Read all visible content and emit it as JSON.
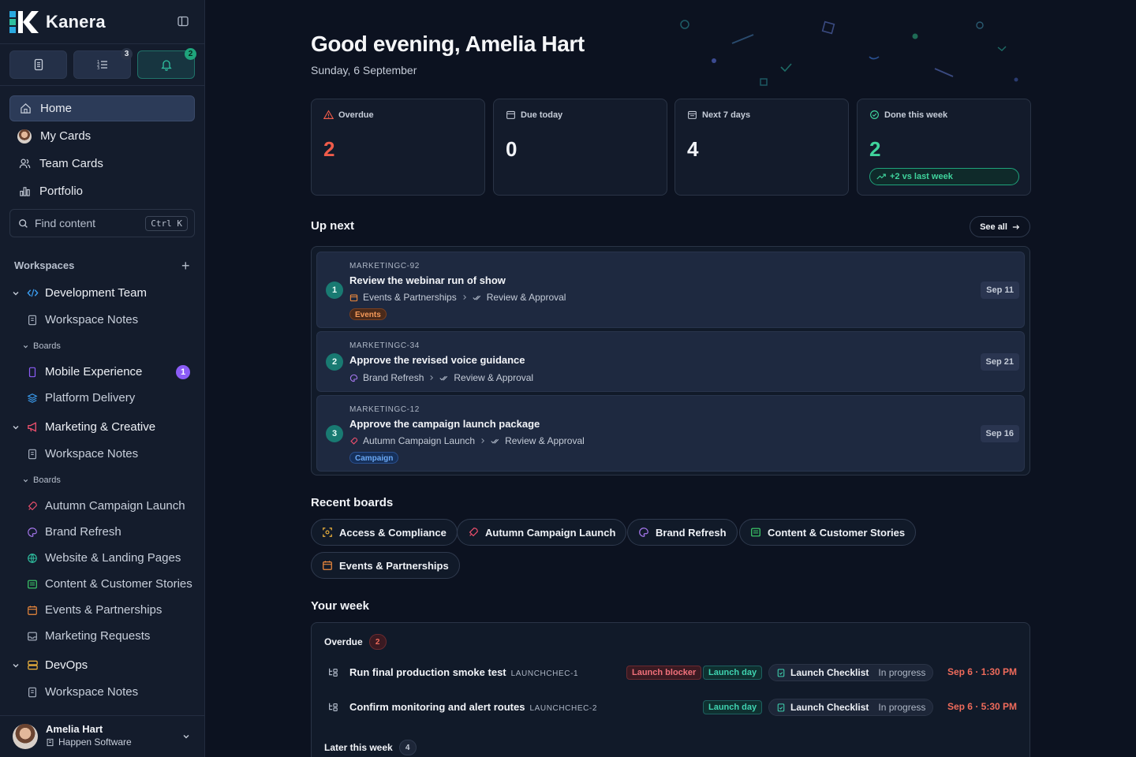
{
  "brand": {
    "name": "Kanera"
  },
  "quick_actions": [
    {
      "icon": "document-icon"
    },
    {
      "icon": "list-icon",
      "badge": "3"
    },
    {
      "icon": "bell-icon",
      "badge": "2"
    }
  ],
  "nav": [
    {
      "label": "Home",
      "icon": "home-icon"
    },
    {
      "label": "My Cards",
      "icon": "avatar"
    },
    {
      "label": "Team Cards",
      "icon": "users-icon"
    },
    {
      "label": "Portfolio",
      "icon": "chart-icon"
    }
  ],
  "search": {
    "placeholder": "Find content",
    "shortcut": "Ctrl K"
  },
  "workspaces": {
    "heading": "Workspaces",
    "items": [
      {
        "name": "Development Team",
        "notes": "Workspace Notes",
        "boards_label": "Boards",
        "boards": [
          {
            "name": "Mobile Experience",
            "badge": "1"
          },
          {
            "name": "Platform Delivery"
          }
        ]
      },
      {
        "name": "Marketing & Creative",
        "notes": "Workspace Notes",
        "boards_label": "Boards",
        "boards": [
          {
            "name": "Autumn Campaign Launch"
          },
          {
            "name": "Brand Refresh"
          },
          {
            "name": "Website & Landing Pages"
          },
          {
            "name": "Content & Customer Stories"
          },
          {
            "name": "Events & Partnerships"
          },
          {
            "name": "Marketing Requests"
          }
        ]
      },
      {
        "name": "DevOps",
        "notes": "Workspace Notes"
      }
    ]
  },
  "user": {
    "name": "Amelia Hart",
    "org": "Happen Software"
  },
  "greeting": "Good evening, Amelia Hart",
  "date": "Sunday, 6 September",
  "stats": [
    {
      "label": "Overdue",
      "value": "2",
      "color": "#ef5b4a"
    },
    {
      "label": "Due today",
      "value": "0",
      "color": "#f2f4f8"
    },
    {
      "label": "Next 7 days",
      "value": "4",
      "color": "#f2f4f8"
    },
    {
      "label": "Done this week",
      "value": "2",
      "color": "#3fd39c",
      "trend": "+2 vs last week"
    }
  ],
  "up_next": {
    "title": "Up next",
    "see_all": "See all",
    "cards": [
      {
        "num": "1",
        "key": "MARKETINGC-92",
        "title": "Review the webinar run of show",
        "board": "Events & Partnerships",
        "list": "Review & Approval",
        "tag": "Events",
        "date": "Sep 11"
      },
      {
        "num": "2",
        "key": "MARKETINGC-34",
        "title": "Approve the revised voice guidance",
        "board": "Brand Refresh",
        "list": "Review & Approval",
        "date": "Sep 21"
      },
      {
        "num": "3",
        "key": "MARKETINGC-12",
        "title": "Approve the campaign launch package",
        "board": "Autumn Campaign Launch",
        "list": "Review & Approval",
        "tag": "Campaign",
        "date": "Sep 16"
      }
    ]
  },
  "recent_boards": {
    "title": "Recent boards",
    "items": [
      "Access & Compliance",
      "Autumn Campaign Launch",
      "Brand Refresh",
      "Content & Customer Stories",
      "Events & Partnerships"
    ]
  },
  "week": {
    "title": "Your week",
    "overdue": {
      "label": "Overdue",
      "count": "2",
      "rows": [
        {
          "title": "Run final production smoke test",
          "key": "LAUNCHCHEC-1",
          "tags": [
            "Launch blocker",
            "Launch day"
          ],
          "board": "Launch Checklist",
          "status": "In progress",
          "due": "Sep 6 · 1:30 PM"
        },
        {
          "title": "Confirm monitoring and alert routes",
          "key": "LAUNCHCHEC-2",
          "tags": [
            "Launch day"
          ],
          "board": "Launch Checklist",
          "status": "In progress",
          "due": "Sep 6 · 5:30 PM"
        }
      ]
    },
    "later": {
      "label": "Later this week",
      "count": "4"
    }
  }
}
